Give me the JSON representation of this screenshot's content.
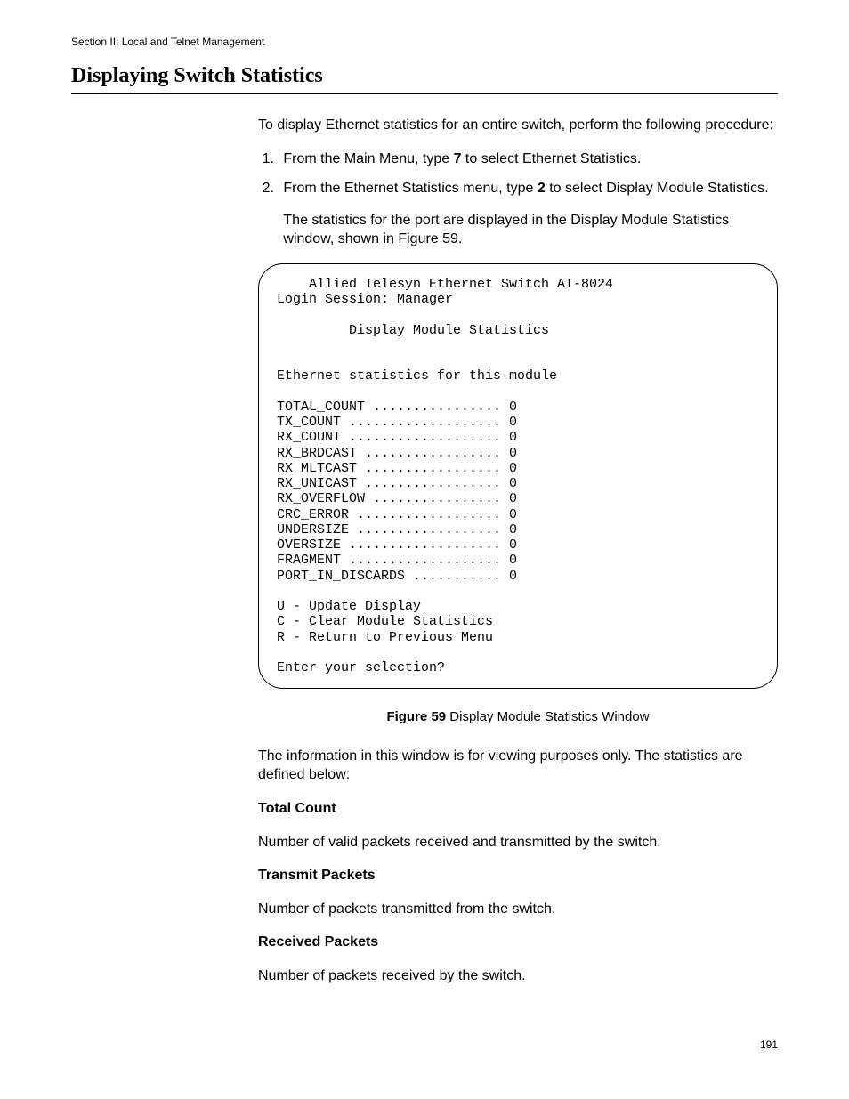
{
  "header": {
    "section_label": "Section II: Local and Telnet Management"
  },
  "title": "Displaying Switch Statistics",
  "intro": "To display Ethernet statistics for an entire switch, perform the following procedure:",
  "steps": [
    {
      "pre": "From the Main Menu, type ",
      "bold": "7",
      "post": " to select Ethernet Statistics."
    },
    {
      "pre": "From the Ethernet Statistics menu, type ",
      "bold": "2",
      "post": " to select Display Module Statistics."
    }
  ],
  "after_steps": "The statistics for the port are displayed in the Display Module Statistics window, shown in Figure 59.",
  "terminal": {
    "title_line": "Allied Telesyn Ethernet Switch AT-8024",
    "login_line": "Login Session: Manager",
    "subtitle": "Display Module Statistics",
    "section_label": "Ethernet statistics for this module",
    "stats": [
      {
        "name": "TOTAL_COUNT",
        "dots": "................",
        "value": "0"
      },
      {
        "name": "TX_COUNT",
        "dots": "...................",
        "value": "0"
      },
      {
        "name": "RX_COUNT",
        "dots": "...................",
        "value": "0"
      },
      {
        "name": "RX_BRDCAST",
        "dots": ".................",
        "value": "0"
      },
      {
        "name": "RX_MLTCAST",
        "dots": ".................",
        "value": "0"
      },
      {
        "name": "RX_UNICAST",
        "dots": ".................",
        "value": "0"
      },
      {
        "name": "RX_OVERFLOW",
        "dots": "................",
        "value": "0"
      },
      {
        "name": "CRC_ERROR",
        "dots": "..................",
        "value": "0"
      },
      {
        "name": "UNDERSIZE",
        "dots": "..................",
        "value": "0"
      },
      {
        "name": "OVERSIZE",
        "dots": "...................",
        "value": "0"
      },
      {
        "name": "FRAGMENT",
        "dots": "...................",
        "value": "0"
      },
      {
        "name": "PORT_IN_DISCARDS",
        "dots": "...........",
        "value": "0"
      }
    ],
    "menu": [
      "U - Update Display",
      "C - Clear Module Statistics",
      "R - Return to Previous Menu"
    ],
    "prompt": "Enter your selection?"
  },
  "figure": {
    "label": "Figure 59",
    "caption": "  Display Module Statistics Window"
  },
  "post_figure": "The information in this window is for viewing purposes only. The statistics are defined below:",
  "definitions": [
    {
      "term": "Total Count",
      "desc": "Number of valid packets received and transmitted by the switch."
    },
    {
      "term": "Transmit Packets",
      "desc": "Number of packets transmitted from the switch."
    },
    {
      "term": "Received Packets",
      "desc": "Number of packets received by the switch."
    }
  ],
  "page_number": "191"
}
